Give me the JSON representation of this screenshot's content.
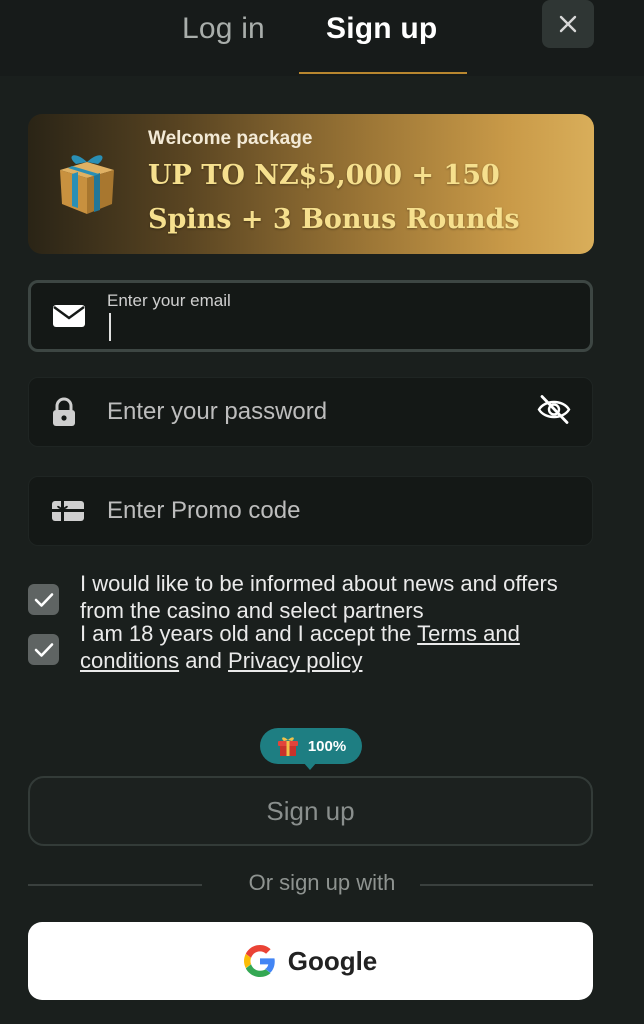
{
  "tabs": {
    "login_label": "Log in",
    "signup_label": "Sign up",
    "active": "signup"
  },
  "close_icon": "close-icon",
  "banner": {
    "kicker": "Welcome package",
    "headline": "UP TO NZ$5,000 + 150 Spins + 3 Bonus Rounds",
    "icon": "gift-icon",
    "gradient_colors": [
      "#2a2416",
      "#d9ae5a"
    ],
    "headline_color": "#f6e08e"
  },
  "form": {
    "email": {
      "label": "Enter your email",
      "value": "",
      "icon": "envelope-icon"
    },
    "password": {
      "placeholder": "Enter your password",
      "value": "",
      "icon": "lock-icon",
      "toggle_icon": "eye-off-icon"
    },
    "promo": {
      "placeholder": "Enter Promo code",
      "value": "",
      "icon": "gift-card-icon"
    }
  },
  "checkboxes": [
    {
      "checked": true,
      "text": "I would like to be informed about news and offers from the casino and select partners"
    },
    {
      "checked": true,
      "text_prefix": "I am 18 years old and I accept the ",
      "terms_link": "Terms and conditions",
      "middle": " and ",
      "privacy_link": "Privacy policy"
    }
  ],
  "bonus_badge": {
    "icon": "gift-icon",
    "text": "100%",
    "color": "#1e7e82"
  },
  "signup_button_label": "Sign up",
  "divider_text": "Or sign up with",
  "google_button": {
    "label": "Google",
    "icon": "google-icon"
  },
  "colors": {
    "background": "#1a1f1d",
    "accent": "#b8862f"
  }
}
